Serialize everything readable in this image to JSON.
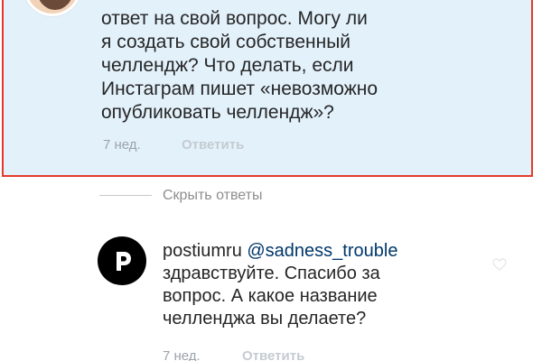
{
  "comment": {
    "lines": [
      "ответ на свой вопрос. Могу ли",
      "я создать свой собственный",
      "челлендж? Что делать, если",
      "Инстаграм пишет «невозможно",
      "опубликовать челлендж»?"
    ],
    "time": "7 нед.",
    "reply_label": "Ответить"
  },
  "thread": {
    "hide_replies_label": "Скрыть ответы"
  },
  "reply": {
    "username": "postiumru",
    "mention": "@sadness_trouble",
    "lines": [
      "здравствуйте. Спасибо за",
      "вопрос. А какое название",
      "челленджа вы делаете?"
    ],
    "time": "7 нед.",
    "reply_label": "Ответить"
  },
  "colors": {
    "highlight_border": "#e43a2c",
    "highlight_bg": "#e3f1fb",
    "mention": "#00376b"
  }
}
